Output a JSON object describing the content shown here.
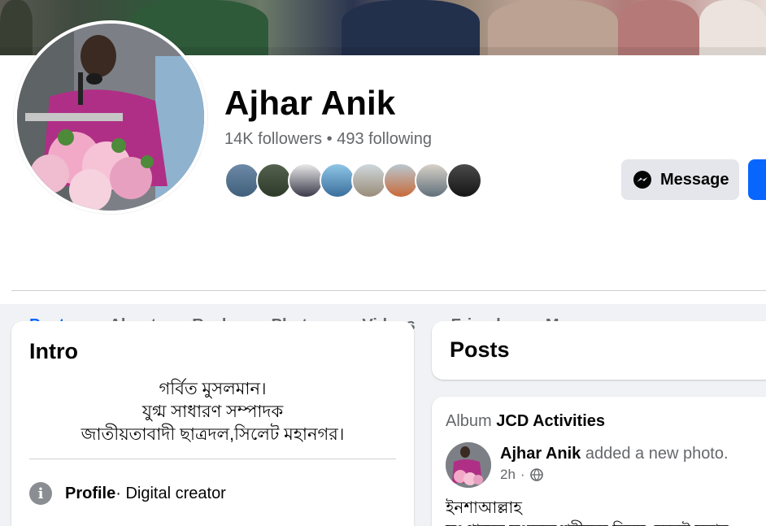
{
  "profile": {
    "name": "Ajhar Anik",
    "followers": "14K followers",
    "separator": "•",
    "following": "493 following"
  },
  "actions": {
    "message_label": "Message",
    "message_icon": "messenger-icon"
  },
  "tabs": [
    {
      "label": "Posts",
      "active": true
    },
    {
      "label": "About"
    },
    {
      "label": "Reels"
    },
    {
      "label": "Photos"
    },
    {
      "label": "Videos"
    },
    {
      "label": "Friends"
    },
    {
      "label": "More"
    }
  ],
  "intro": {
    "title": "Intro",
    "bio_line1": "গর্বিত মুসলমান।",
    "bio_line2": "যুগ্ম সাধারণ সম্পাদক",
    "bio_line3": "জাতীয়তাবাদী ছাত্রদল,সিলেট মহানগর।",
    "profile_label": "Profile",
    "profile_value": " · Digital creator",
    "info_icon": "info-icon"
  },
  "posts_section": {
    "title": "Posts"
  },
  "post": {
    "album_prefix": "Album",
    "album_name": "JCD Activities",
    "author": "Ajhar Anik",
    "action": "added a new photo.",
    "time": "2h",
    "audience_icon": "globe-icon",
    "text_line1": "ইনশাআল্লাহ",
    "text_line2": "সংগ্রামের সংকল্পে শহীদের নিয়ম মেনেই সবার"
  },
  "colors": {
    "accent": "#0866ff",
    "secondary_text": "#65676b",
    "page_bg": "#f0f2f5",
    "button_gray": "#e4e6eb"
  }
}
